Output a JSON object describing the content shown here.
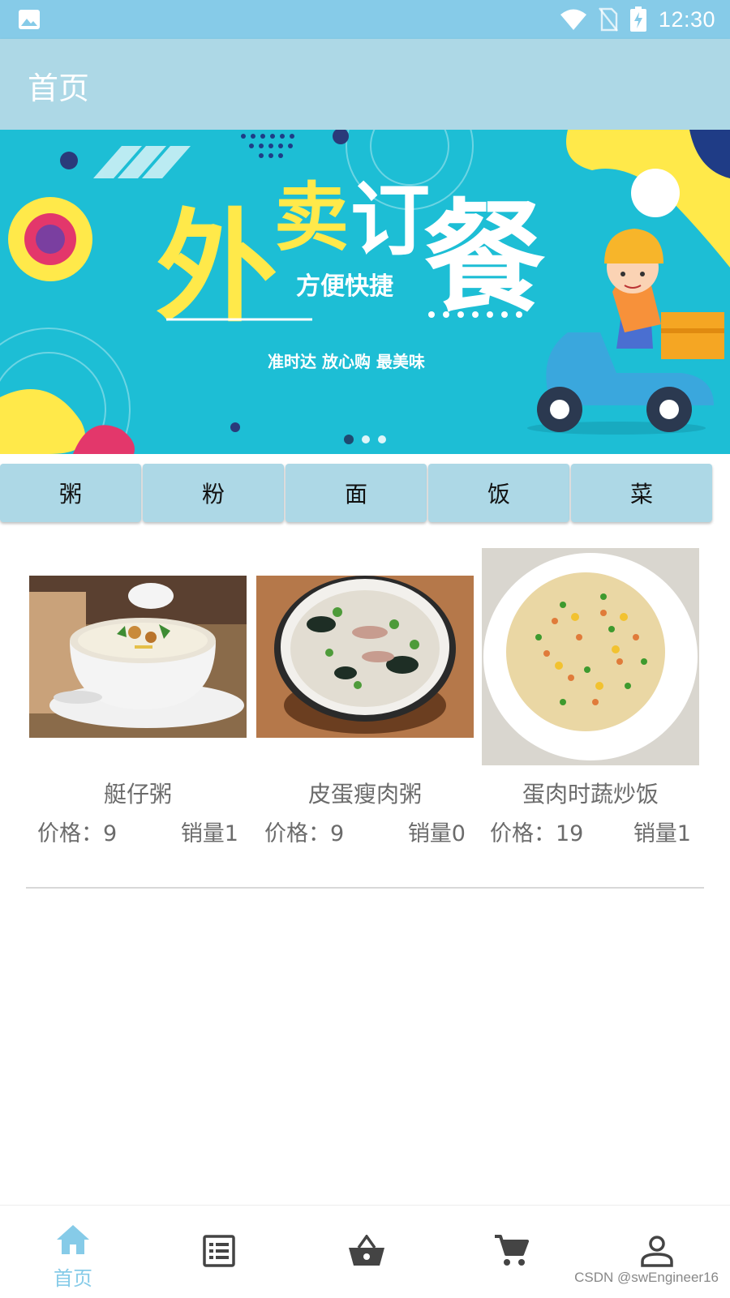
{
  "status_bar": {
    "time": "12:30"
  },
  "app_bar": {
    "title": "首页"
  },
  "banner": {
    "headline_chars": [
      "外",
      "卖",
      "订",
      "餐"
    ],
    "sub_headline": "方便快捷",
    "tagline": "准时达  放心购  最美味",
    "page_indicator": {
      "count": 3,
      "active": 0
    }
  },
  "categories": [
    {
      "label": "粥"
    },
    {
      "label": "粉"
    },
    {
      "label": "面"
    },
    {
      "label": "饭"
    },
    {
      "label": "菜"
    }
  ],
  "foods": [
    {
      "name": "艇仔粥",
      "price": "价格：9",
      "sales": "销量1"
    },
    {
      "name": "皮蛋瘦肉粥",
      "price": "价格：9",
      "sales": "销量0"
    },
    {
      "name": "蛋肉时蔬炒饭",
      "price": "价格：19",
      "sales": "销量1"
    }
  ],
  "bottom_nav": [
    {
      "label": "首页",
      "icon": "home-icon",
      "active": true
    },
    {
      "label": "",
      "icon": "list-icon",
      "active": false
    },
    {
      "label": "",
      "icon": "basket-icon",
      "active": false
    },
    {
      "label": "",
      "icon": "cart-icon",
      "active": false
    },
    {
      "label": "",
      "icon": "person-icon",
      "active": false
    }
  ],
  "watermark": "CSDN @swEngineer16",
  "colors": {
    "status_bar": "#86CBE8",
    "app_bar": "#ADD8E6",
    "banner_bg": "#1DBED5",
    "banner_yellow": "#FFE94A",
    "nav_active": "#86CBE8",
    "nav_inactive": "#444444"
  }
}
